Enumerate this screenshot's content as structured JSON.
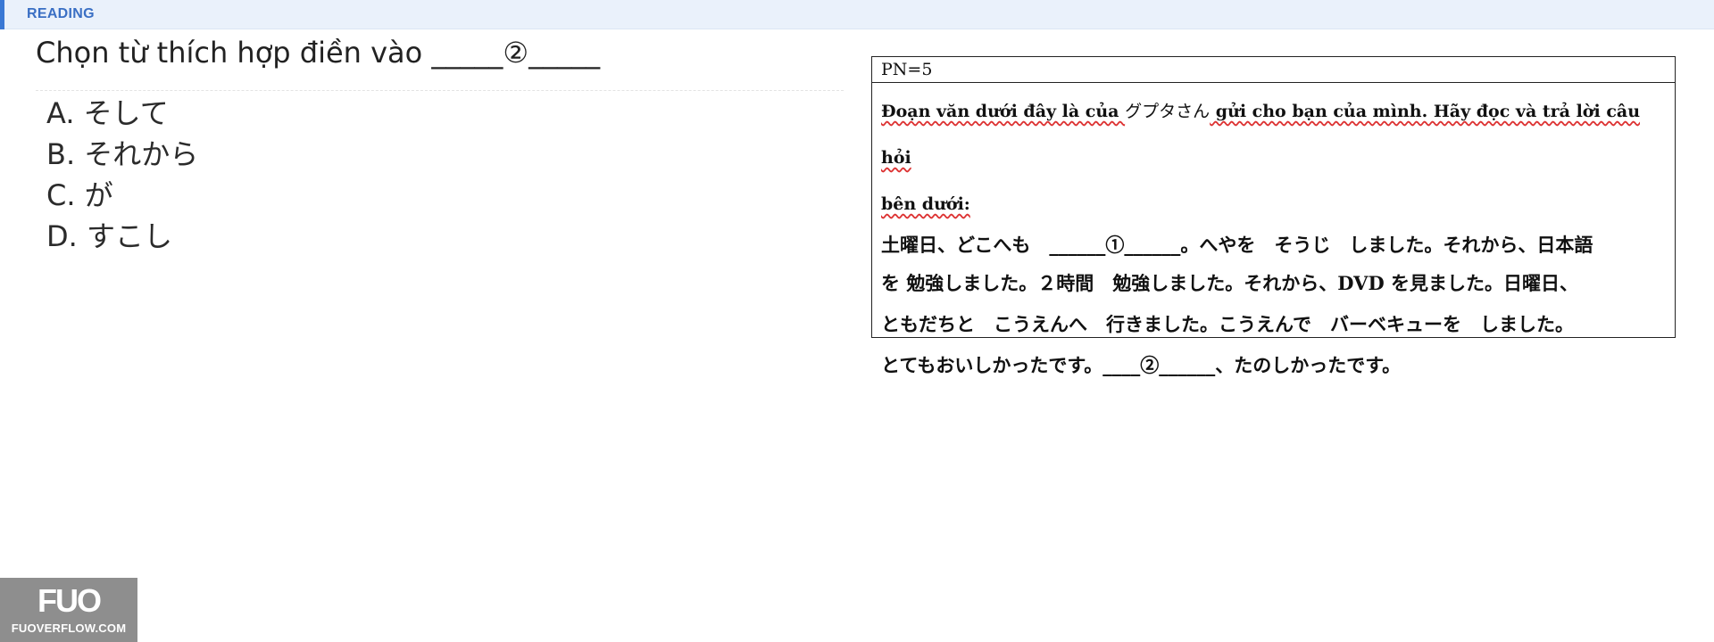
{
  "header": {
    "section_label": "READING"
  },
  "question": {
    "prompt": "Chọn từ thích hợp điền vào _____②_____"
  },
  "options": [
    {
      "label": "A. そして"
    },
    {
      "label": "B. それから"
    },
    {
      "label": "C. が"
    },
    {
      "label": "D. すこし"
    }
  ],
  "passage": {
    "pn": "PN=5",
    "instruction_parts": [
      "Đoạn văn dưới đây là của ",
      "グプタさん",
      " gửi cho bạn của mình. Hãy đọc và trả lời câu hỏi",
      "bên dưới:"
    ],
    "lines": [
      "土曜日、どこへも　______①______。へやを　そうじ　しました。それから、日本語",
      "を 勉強しました。２時間　勉強しました。それから、DVD を見ました。日曜日、",
      "ともだちと　こうえんへ　行きました。こうえんで　バーベキューを　しました。",
      "とてもおいしかったです。____②______、たのしかったです。"
    ]
  },
  "logo": {
    "mark": "FUO",
    "site": "FUOVERFLOW.COM"
  },
  "colors": {
    "accent": "#3a78d4",
    "header_bg": "#eaf1fb",
    "logo_bg": "#8e8e8e"
  }
}
